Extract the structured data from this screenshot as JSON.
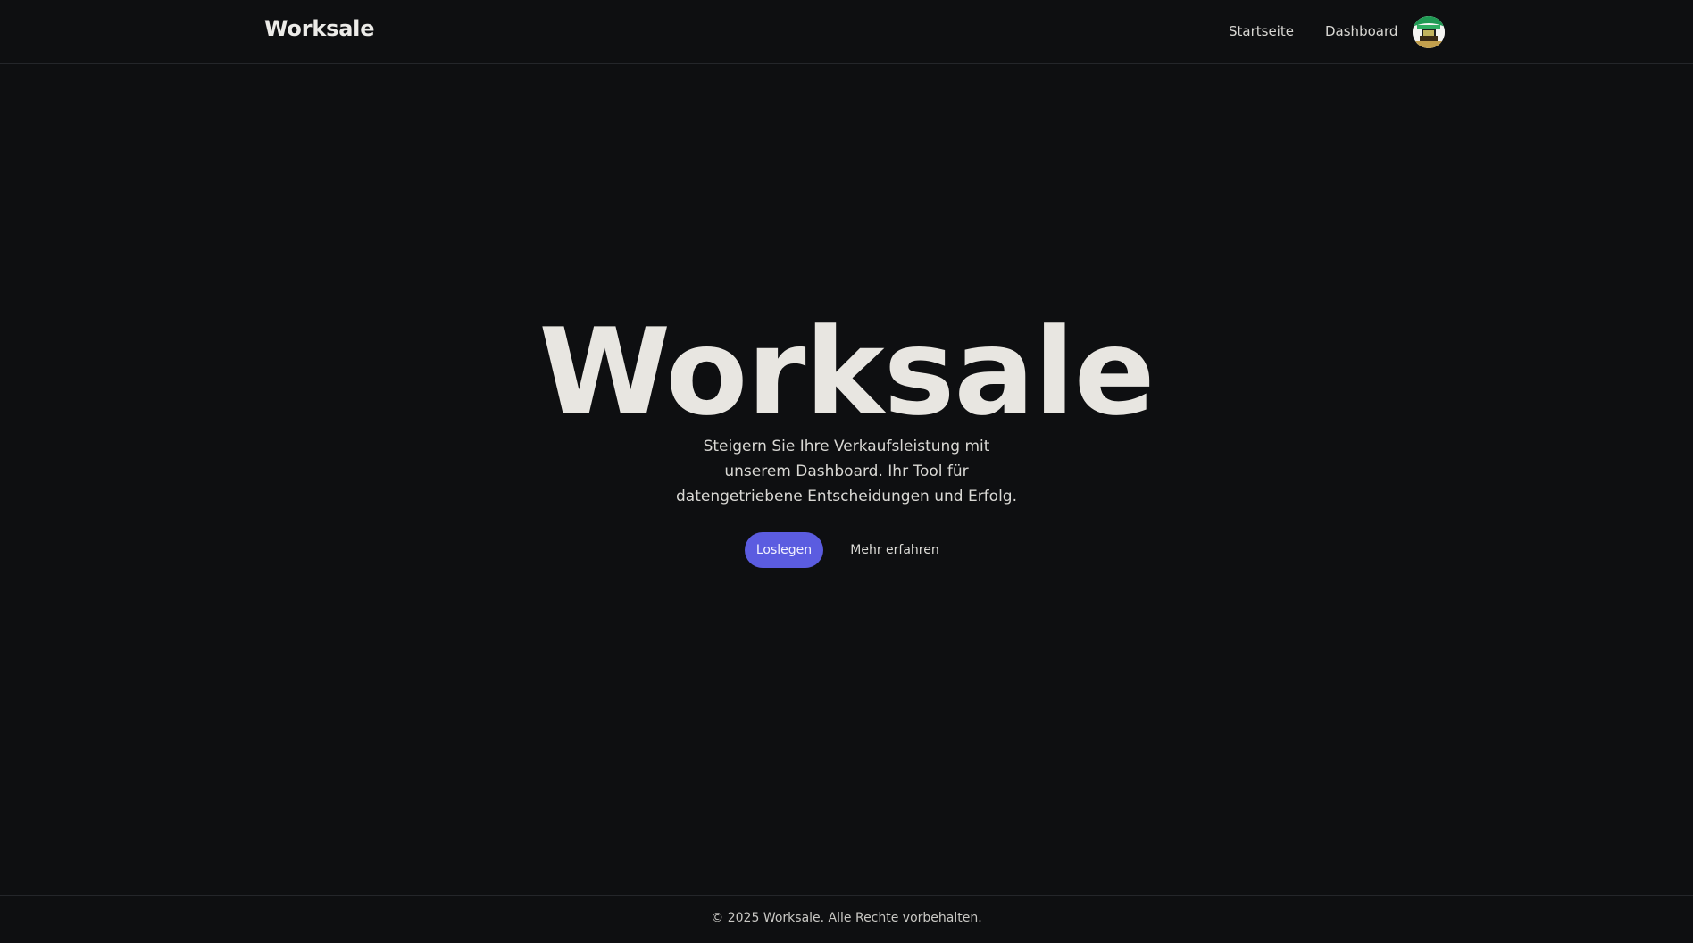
{
  "header": {
    "brand": "Worksale",
    "nav": {
      "home_label": "Startseite",
      "dashboard_label": "Dashboard"
    },
    "avatar": {
      "icon": "user-avatar"
    }
  },
  "hero": {
    "title": "Worksale",
    "subtitle": "Steigern Sie Ihre Verkaufsleistung mit unserem Dashboard. Ihr Tool für datengetriebene Entscheidungen und Erfolg.",
    "primary_cta": "Loslegen",
    "secondary_cta": "Mehr erfahren"
  },
  "footer": {
    "copyright": "© 2025 Worksale. Alle Rechte vorbehalten."
  },
  "colors": {
    "background": "#0e0f11",
    "accent": "#5b5ce0",
    "text": "#e8e6e1"
  }
}
